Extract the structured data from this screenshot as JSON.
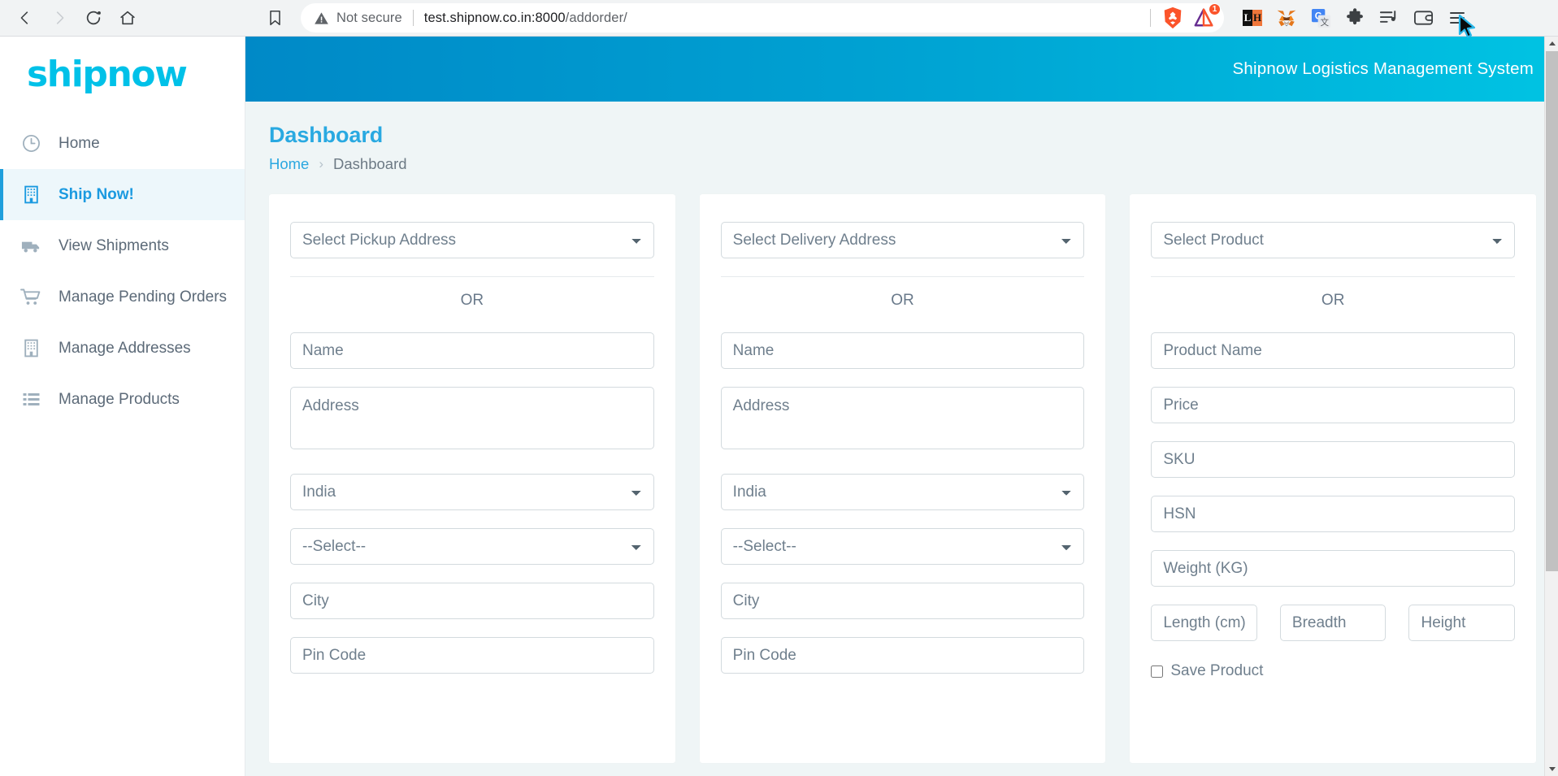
{
  "browser": {
    "nav": {
      "back_label": "Back",
      "forward_label": "Forward",
      "reload_label": "Reload",
      "home_label": "Home"
    },
    "bookmark_label": "Bookmark this tab",
    "security_label": "Not secure",
    "url_host": "test.shipnow.co.in:8000",
    "url_path": "/addorder/",
    "brave_shields_label": "Brave Shields",
    "rewards_badge": "1",
    "extensions": [
      {
        "name": "lastpass-icon",
        "label": "LH"
      },
      {
        "name": "metamask-icon",
        "label": "MetaMask"
      },
      {
        "name": "google-translate-icon",
        "label": "Translate"
      },
      {
        "name": "extensions-puzzle-icon",
        "label": "Extensions"
      },
      {
        "name": "playlist-icon",
        "label": "Brave Playlist"
      },
      {
        "name": "wallet-icon",
        "label": "Brave Wallet"
      },
      {
        "name": "browser-menu-icon",
        "label": "Customize and control Brave"
      }
    ]
  },
  "app": {
    "logo_text": "shipnow",
    "topbar_title": "Shipnow Logistics Management System"
  },
  "sidebar": {
    "items": [
      {
        "label": "Home",
        "icon": "clock-icon",
        "active": false
      },
      {
        "label": "Ship Now!",
        "icon": "building-icon",
        "active": true
      },
      {
        "label": "View Shipments",
        "icon": "truck-icon",
        "active": false
      },
      {
        "label": "Manage Pending Orders",
        "icon": "cart-icon",
        "active": false
      },
      {
        "label": "Manage Addresses",
        "icon": "building-icon",
        "active": false
      },
      {
        "label": "Manage Products",
        "icon": "list-icon",
        "active": false
      }
    ]
  },
  "page": {
    "title": "Dashboard",
    "breadcrumb": {
      "home": "Home",
      "separator": "›",
      "current": "Dashboard"
    }
  },
  "pickup": {
    "select_value": "Select Pickup Address",
    "or": "OR",
    "name_placeholder": "Name",
    "address_placeholder": "Address",
    "country_value": "India",
    "state_value": "--Select--",
    "city_placeholder": "City",
    "pincode_placeholder": "Pin Code"
  },
  "delivery": {
    "select_value": "Select Delivery Address",
    "or": "OR",
    "name_placeholder": "Name",
    "address_placeholder": "Address",
    "country_value": "India",
    "state_value": "--Select--",
    "city_placeholder": "City",
    "pincode_placeholder": "Pin Code"
  },
  "product": {
    "select_value": "Select Product",
    "or": "OR",
    "name_placeholder": "Product Name",
    "price_placeholder": "Price",
    "sku_placeholder": "SKU",
    "hsn_placeholder": "HSN",
    "weight_placeholder": "Weight (KG)",
    "length_placeholder": "Length (cm)",
    "breadth_placeholder": "Breadth",
    "height_placeholder": "Height",
    "save_product_label": "Save Product"
  },
  "colors": {
    "brand_cyan": "#00c1e8",
    "topbar_from": "#0089c7",
    "topbar_to": "#00c3e3",
    "accent_blue": "#29a9e1",
    "page_bg": "#eff5f6",
    "field_border": "#d3dade",
    "text_muted": "#6f7f8d"
  }
}
